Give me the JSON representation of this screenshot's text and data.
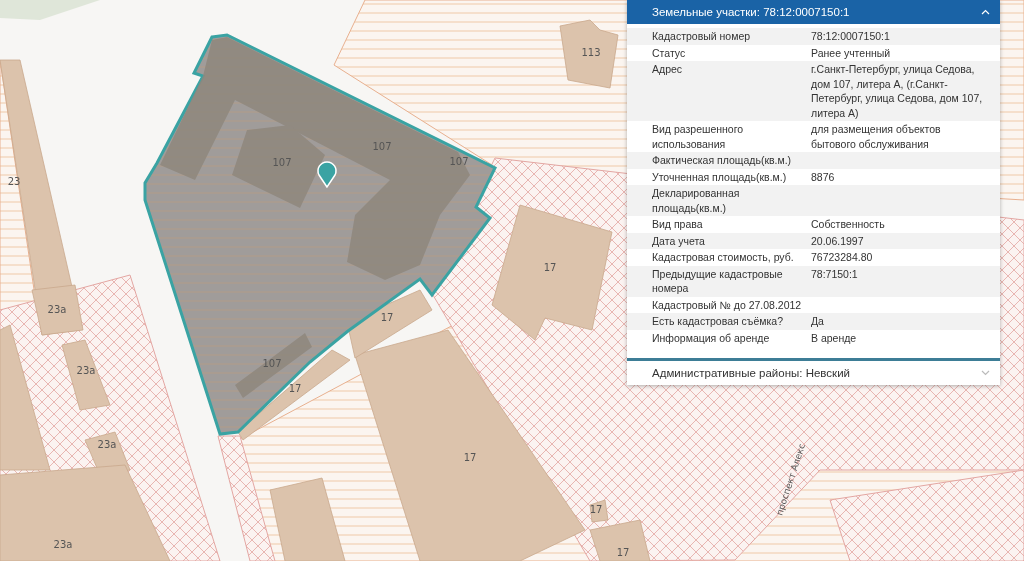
{
  "map": {
    "labels": [
      "113",
      "107",
      "107",
      "107",
      "23",
      "17",
      "23а",
      "17",
      "23а",
      "107",
      "17",
      "23а",
      "17",
      "17",
      "23а",
      "17"
    ],
    "road_label": "проспект Алекс"
  },
  "panel": {
    "sections": [
      {
        "title": "Земельные участки: 78:12:0007150:1",
        "expanded": true,
        "rows": [
          {
            "label": "Кадастровый номер",
            "value": "78:12:0007150:1"
          },
          {
            "label": "Статус",
            "value": "Ранее учтенный"
          },
          {
            "label": "Адрес",
            "value": "г.Санкт-Петербург, улица Седова, дом 107, литера А, (г.Санкт-Петербург, улица Седова, дом 107, литера А)"
          },
          {
            "label": "Вид разрешенного использования",
            "value": "для размещения объектов бытового обслуживания"
          },
          {
            "label": "Фактическая площадь(кв.м.)"
          },
          {
            "label": "Уточненная площадь(кв.м.)",
            "value": "8876"
          },
          {
            "label": "Декларированная площадь(кв.м.)"
          },
          {
            "label": "Вид права",
            "value": "Собственность"
          },
          {
            "label": "Дата учета",
            "value": "20.06.1997"
          },
          {
            "label": "Кадастровая стоимость, руб.",
            "value": "76723284.80"
          },
          {
            "label": "Предыдущие кадастровые номера",
            "value": "78:7150:1"
          },
          {
            "label": "Кадастровый № до 27.08.2012"
          },
          {
            "label": "Есть кадастровая съёмка?",
            "value": "Да"
          },
          {
            "label": "Информация об аренде",
            "value": "В аренде"
          }
        ]
      },
      {
        "title": "Административные районы: Невский",
        "expanded": false
      }
    ]
  }
}
